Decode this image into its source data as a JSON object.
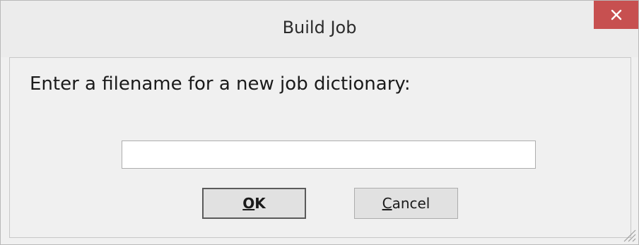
{
  "window": {
    "title": "Build Job",
    "close_icon": "close-icon"
  },
  "dialog": {
    "prompt": "Enter a filename for a new job dictionary:",
    "filename_value": "",
    "filename_placeholder": ""
  },
  "buttons": {
    "ok_label_mnemonic": "O",
    "ok_label_rest": "K",
    "cancel_label_mnemonic": "C",
    "cancel_label_rest": "ancel"
  },
  "colors": {
    "close_button": "#c75050",
    "window_background": "#f0f0f0",
    "button_face": "#e1e1e1"
  }
}
